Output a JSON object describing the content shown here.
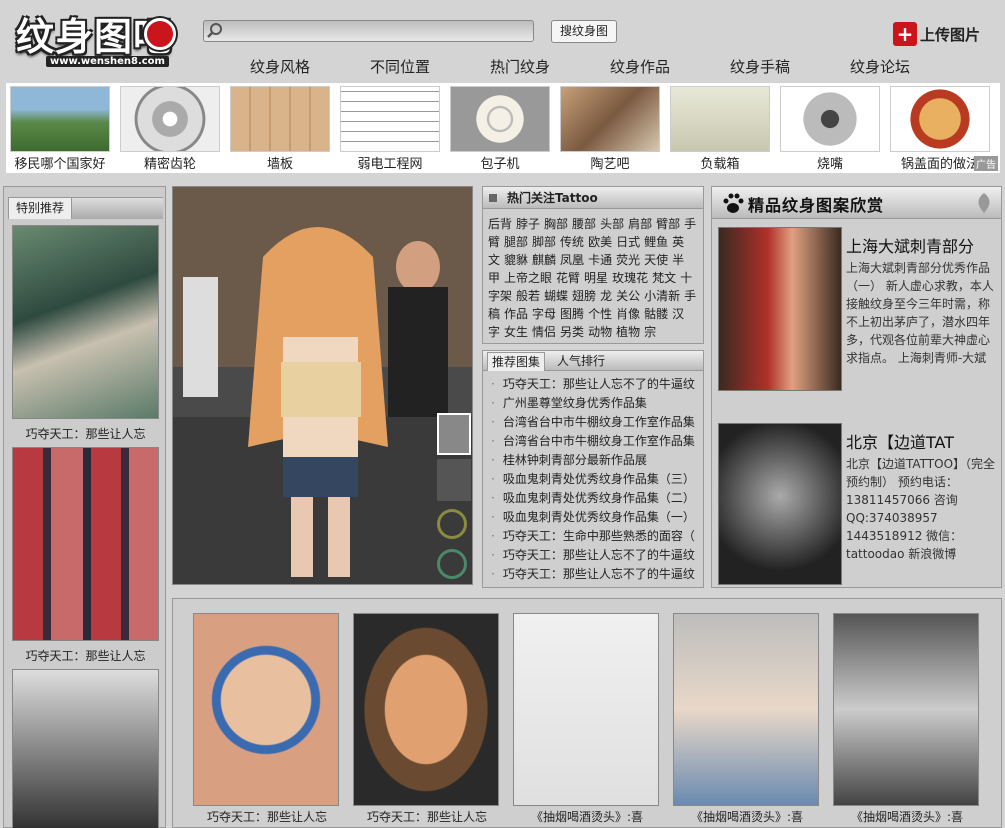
{
  "header": {
    "logo_text": "纹身图吧",
    "logo_url": "www.wenshen8.com",
    "search_placeholder": "",
    "search_button": "搜纹身图",
    "upload_label": "上传图片",
    "upload_icon": "plus-icon"
  },
  "nav": [
    "纹身风格",
    "不同位置",
    "热门纹身",
    "纹身作品",
    "纹身手稿",
    "纹身论坛"
  ],
  "ad_strip": {
    "items": [
      "移民哪个国家好",
      "精密齿轮",
      "墙板",
      "弱电工程网",
      "包子机",
      "陶艺吧",
      "负载箱",
      "烧嘴",
      "锅盖面的做法"
    ],
    "ad_tag": "广告"
  },
  "left_panel": {
    "tab": "特别推荐",
    "captions": [
      "巧夺天工：那些让人忘",
      "巧夺天工：那些让人忘"
    ]
  },
  "hot": {
    "title": "热门关注Tattoo",
    "tags": [
      "后背",
      "脖子",
      "胸部",
      "腰部",
      "头部",
      "肩部",
      "臂部",
      "手臂",
      "腿部",
      "脚部",
      "传统",
      "欧美",
      "日式",
      "鲤鱼",
      "英文",
      "貔貅",
      "麒麟",
      "凤凰",
      "卡通",
      "荧光",
      "天使",
      "半甲",
      "上帝之眼",
      "花臂",
      "明星",
      "玫瑰花",
      "梵文",
      "十字架",
      "般若",
      "蝴蝶",
      "翅膀",
      "龙",
      "关公",
      "小清新",
      "手稿",
      "作品",
      "字母",
      "图腾",
      "个性",
      "肖像",
      "骷髅",
      "汉字",
      "女生",
      "情侣",
      "另类",
      "动物",
      "植物",
      "宗"
    ]
  },
  "gallery_list": {
    "tab_active": "推荐图集",
    "tab_other": "人气排行",
    "items": [
      "巧夺天工：那些让人忘不了的牛逼纹",
      "广州墨尊堂纹身优秀作品集",
      "台湾省台中市牛棚纹身工作室作品集",
      "台湾省台中市牛棚纹身工作室作品集",
      "桂林钟刺青部分最新作品展",
      "吸血鬼刺青处优秀纹身作品集（三）",
      "吸血鬼刺青处优秀纹身作品集（二）",
      "吸血鬼刺青处优秀纹身作品集（一）",
      "巧夺天工：生命中那些熟悉的面容（",
      "巧夺天工：那些让人忘不了的牛逼纹",
      "巧夺天工：那些让人忘不了的牛逼纹"
    ]
  },
  "featured": {
    "title": "精品纹身图案欣赏",
    "shops": [
      {
        "name": "上海大斌刺青部分",
        "desc": "上海大斌刺青部分优秀作品（一） 新人虚心求教，本人接触纹身至今三年时需，称不上初出茅庐了，潜水四年多，代观各位前辈大神虚心求指点。 上海刺青师-大斌"
      },
      {
        "name": "北京【边道TAT",
        "desc": "北京【边道TATTOO】（完全预约制） 预约电话：13811457066 咨询QQ:374038957 1443518912 微信：tattoodao 新浪微博"
      }
    ]
  },
  "bottom_gallery": {
    "captions": [
      "巧夺天工：那些让人忘",
      "巧夺天工：那些让人忘",
      "《抽烟喝酒烫头》:喜",
      "《抽烟喝酒烫头》:喜",
      "《抽烟喝酒烫头》:喜"
    ]
  },
  "colors": {
    "accent_red": "#c9151b",
    "background": "#d4d4d4"
  }
}
